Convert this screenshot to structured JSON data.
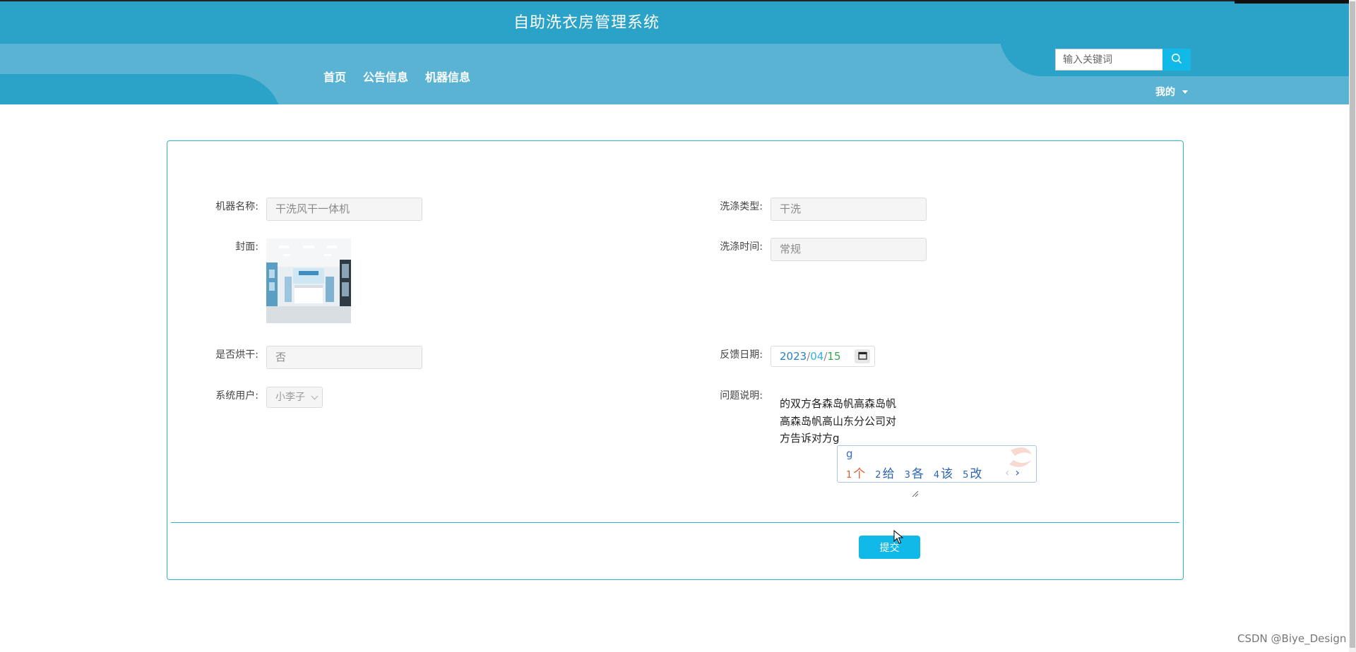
{
  "header": {
    "title": "自助洗衣房管理系统",
    "nav": [
      "首页",
      "公告信息",
      "机器信息"
    ],
    "search": {
      "placeholder": "输入关键词"
    },
    "user_menu": "我的"
  },
  "form": {
    "machine_name": {
      "label": "机器名称:",
      "value": "干洗风干一体机"
    },
    "wash_type": {
      "label": "洗涤类型:",
      "value": "干洗"
    },
    "cover": {
      "label": "封面:"
    },
    "wash_time": {
      "label": "洗涤时间:",
      "value": "常规"
    },
    "dry": {
      "label": "是否烘干:",
      "value": "否"
    },
    "feedback_date": {
      "label": "反馈日期:",
      "year": "2023",
      "month": "04",
      "day": "15",
      "sep": "/"
    },
    "system_user": {
      "label": "系统用户:",
      "value": "小李子"
    },
    "problem": {
      "label": "问题说明:",
      "lines": [
        "的双方各森岛帆高森岛帆",
        "高森岛帆高山东分公司对",
        "方告诉对方g"
      ]
    },
    "submit_label": "提交"
  },
  "ime": {
    "input": "g",
    "candidates": [
      {
        "num": "1",
        "text": "个"
      },
      {
        "num": "2",
        "text": "给"
      },
      {
        "num": "3",
        "text": "各"
      },
      {
        "num": "4",
        "text": "该"
      },
      {
        "num": "5",
        "text": "改"
      }
    ],
    "prev": "‹",
    "next": "›"
  },
  "watermark": "CSDN @Biye_Design",
  "colors": {
    "header_dark": "#2ba3c9",
    "header_light": "#5bb3d3",
    "accent": "#11b9e8",
    "card_border": "#2fb4c8"
  }
}
